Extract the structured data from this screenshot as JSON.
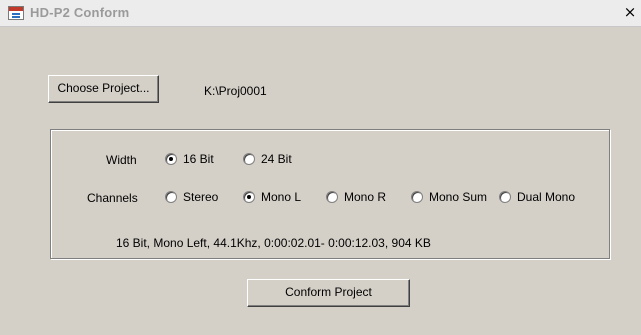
{
  "window": {
    "title": "HD-P2 Conform",
    "close_label": "×"
  },
  "project": {
    "choose_label": "Choose Project...",
    "path": "K:\\Proj0001"
  },
  "width": {
    "label": "Width",
    "options": [
      {
        "label": "16 Bit",
        "selected": true
      },
      {
        "label": "24 Bit",
        "selected": false
      }
    ]
  },
  "channels": {
    "label": "Channels",
    "options": [
      {
        "label": "Stereo",
        "selected": false
      },
      {
        "label": "Mono L",
        "selected": true
      },
      {
        "label": "Mono R",
        "selected": false
      },
      {
        "label": "Mono Sum",
        "selected": false
      },
      {
        "label": "Dual Mono",
        "selected": false
      }
    ]
  },
  "summary": "16 Bit, Mono Left, 44.1Khz,  0:00:02.01- 0:00:12.03, 904 KB",
  "conform_label": "Conform Project"
}
